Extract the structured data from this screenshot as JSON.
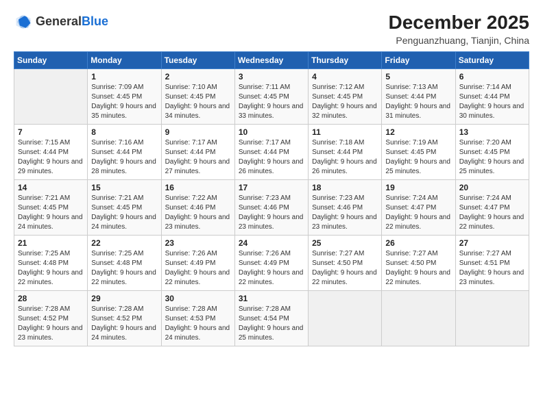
{
  "header": {
    "logo_general": "General",
    "logo_blue": "Blue",
    "month_title": "December 2025",
    "location": "Penguanzhuang, Tianjin, China"
  },
  "calendar": {
    "headers": [
      "Sunday",
      "Monday",
      "Tuesday",
      "Wednesday",
      "Thursday",
      "Friday",
      "Saturday"
    ],
    "weeks": [
      [
        {
          "day": "",
          "sunrise": "",
          "sunset": "",
          "daylight": ""
        },
        {
          "day": "1",
          "sunrise": "Sunrise: 7:09 AM",
          "sunset": "Sunset: 4:45 PM",
          "daylight": "Daylight: 9 hours and 35 minutes."
        },
        {
          "day": "2",
          "sunrise": "Sunrise: 7:10 AM",
          "sunset": "Sunset: 4:45 PM",
          "daylight": "Daylight: 9 hours and 34 minutes."
        },
        {
          "day": "3",
          "sunrise": "Sunrise: 7:11 AM",
          "sunset": "Sunset: 4:45 PM",
          "daylight": "Daylight: 9 hours and 33 minutes."
        },
        {
          "day": "4",
          "sunrise": "Sunrise: 7:12 AM",
          "sunset": "Sunset: 4:45 PM",
          "daylight": "Daylight: 9 hours and 32 minutes."
        },
        {
          "day": "5",
          "sunrise": "Sunrise: 7:13 AM",
          "sunset": "Sunset: 4:44 PM",
          "daylight": "Daylight: 9 hours and 31 minutes."
        },
        {
          "day": "6",
          "sunrise": "Sunrise: 7:14 AM",
          "sunset": "Sunset: 4:44 PM",
          "daylight": "Daylight: 9 hours and 30 minutes."
        }
      ],
      [
        {
          "day": "7",
          "sunrise": "Sunrise: 7:15 AM",
          "sunset": "Sunset: 4:44 PM",
          "daylight": "Daylight: 9 hours and 29 minutes."
        },
        {
          "day": "8",
          "sunrise": "Sunrise: 7:16 AM",
          "sunset": "Sunset: 4:44 PM",
          "daylight": "Daylight: 9 hours and 28 minutes."
        },
        {
          "day": "9",
          "sunrise": "Sunrise: 7:17 AM",
          "sunset": "Sunset: 4:44 PM",
          "daylight": "Daylight: 9 hours and 27 minutes."
        },
        {
          "day": "10",
          "sunrise": "Sunrise: 7:17 AM",
          "sunset": "Sunset: 4:44 PM",
          "daylight": "Daylight: 9 hours and 26 minutes."
        },
        {
          "day": "11",
          "sunrise": "Sunrise: 7:18 AM",
          "sunset": "Sunset: 4:44 PM",
          "daylight": "Daylight: 9 hours and 26 minutes."
        },
        {
          "day": "12",
          "sunrise": "Sunrise: 7:19 AM",
          "sunset": "Sunset: 4:45 PM",
          "daylight": "Daylight: 9 hours and 25 minutes."
        },
        {
          "day": "13",
          "sunrise": "Sunrise: 7:20 AM",
          "sunset": "Sunset: 4:45 PM",
          "daylight": "Daylight: 9 hours and 25 minutes."
        }
      ],
      [
        {
          "day": "14",
          "sunrise": "Sunrise: 7:21 AM",
          "sunset": "Sunset: 4:45 PM",
          "daylight": "Daylight: 9 hours and 24 minutes."
        },
        {
          "day": "15",
          "sunrise": "Sunrise: 7:21 AM",
          "sunset": "Sunset: 4:45 PM",
          "daylight": "Daylight: 9 hours and 24 minutes."
        },
        {
          "day": "16",
          "sunrise": "Sunrise: 7:22 AM",
          "sunset": "Sunset: 4:46 PM",
          "daylight": "Daylight: 9 hours and 23 minutes."
        },
        {
          "day": "17",
          "sunrise": "Sunrise: 7:23 AM",
          "sunset": "Sunset: 4:46 PM",
          "daylight": "Daylight: 9 hours and 23 minutes."
        },
        {
          "day": "18",
          "sunrise": "Sunrise: 7:23 AM",
          "sunset": "Sunset: 4:46 PM",
          "daylight": "Daylight: 9 hours and 23 minutes."
        },
        {
          "day": "19",
          "sunrise": "Sunrise: 7:24 AM",
          "sunset": "Sunset: 4:47 PM",
          "daylight": "Daylight: 9 hours and 22 minutes."
        },
        {
          "day": "20",
          "sunrise": "Sunrise: 7:24 AM",
          "sunset": "Sunset: 4:47 PM",
          "daylight": "Daylight: 9 hours and 22 minutes."
        }
      ],
      [
        {
          "day": "21",
          "sunrise": "Sunrise: 7:25 AM",
          "sunset": "Sunset: 4:48 PM",
          "daylight": "Daylight: 9 hours and 22 minutes."
        },
        {
          "day": "22",
          "sunrise": "Sunrise: 7:25 AM",
          "sunset": "Sunset: 4:48 PM",
          "daylight": "Daylight: 9 hours and 22 minutes."
        },
        {
          "day": "23",
          "sunrise": "Sunrise: 7:26 AM",
          "sunset": "Sunset: 4:49 PM",
          "daylight": "Daylight: 9 hours and 22 minutes."
        },
        {
          "day": "24",
          "sunrise": "Sunrise: 7:26 AM",
          "sunset": "Sunset: 4:49 PM",
          "daylight": "Daylight: 9 hours and 22 minutes."
        },
        {
          "day": "25",
          "sunrise": "Sunrise: 7:27 AM",
          "sunset": "Sunset: 4:50 PM",
          "daylight": "Daylight: 9 hours and 22 minutes."
        },
        {
          "day": "26",
          "sunrise": "Sunrise: 7:27 AM",
          "sunset": "Sunset: 4:50 PM",
          "daylight": "Daylight: 9 hours and 22 minutes."
        },
        {
          "day": "27",
          "sunrise": "Sunrise: 7:27 AM",
          "sunset": "Sunset: 4:51 PM",
          "daylight": "Daylight: 9 hours and 23 minutes."
        }
      ],
      [
        {
          "day": "28",
          "sunrise": "Sunrise: 7:28 AM",
          "sunset": "Sunset: 4:52 PM",
          "daylight": "Daylight: 9 hours and 23 minutes."
        },
        {
          "day": "29",
          "sunrise": "Sunrise: 7:28 AM",
          "sunset": "Sunset: 4:52 PM",
          "daylight": "Daylight: 9 hours and 24 minutes."
        },
        {
          "day": "30",
          "sunrise": "Sunrise: 7:28 AM",
          "sunset": "Sunset: 4:53 PM",
          "daylight": "Daylight: 9 hours and 24 minutes."
        },
        {
          "day": "31",
          "sunrise": "Sunrise: 7:28 AM",
          "sunset": "Sunset: 4:54 PM",
          "daylight": "Daylight: 9 hours and 25 minutes."
        },
        {
          "day": "",
          "sunrise": "",
          "sunset": "",
          "daylight": ""
        },
        {
          "day": "",
          "sunrise": "",
          "sunset": "",
          "daylight": ""
        },
        {
          "day": "",
          "sunrise": "",
          "sunset": "",
          "daylight": ""
        }
      ]
    ]
  }
}
